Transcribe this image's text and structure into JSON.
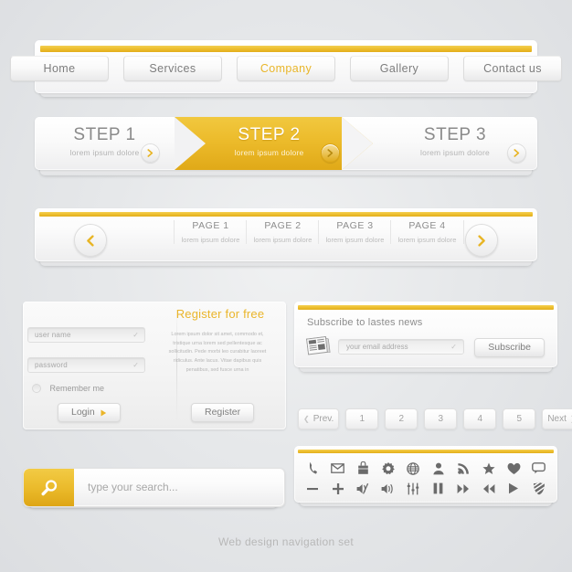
{
  "colors": {
    "accent": "#ebbb2c",
    "accent_dark": "#dea616",
    "text_gray": "#8a8a8a",
    "text_light": "#b4b4b4",
    "panel_bg": "#fafafa",
    "page_bg": "#e6e8ea"
  },
  "top_menu": {
    "items": [
      {
        "label": "Home",
        "active": false
      },
      {
        "label": "Services",
        "active": false
      },
      {
        "label": "Company",
        "active": true
      },
      {
        "label": "Gallery",
        "active": false
      },
      {
        "label": "Contact us",
        "active": false
      }
    ]
  },
  "steps": {
    "items": [
      {
        "title": "STEP 1",
        "subtitle": "lorem ipsum dolore",
        "active": false
      },
      {
        "title": "STEP 2",
        "subtitle": "lorem ipsum dolore",
        "active": true
      },
      {
        "title": "STEP 3",
        "subtitle": "lorem ipsum dolore",
        "active": false
      }
    ]
  },
  "pager": {
    "prev_icon": "chevron-left-icon",
    "next_icon": "chevron-right-icon",
    "pages": [
      {
        "title": "PAGE 1",
        "subtitle": "lorem ipsum dolore"
      },
      {
        "title": "PAGE 2",
        "subtitle": "lorem ipsum dolore"
      },
      {
        "title": "PAGE 3",
        "subtitle": "lorem ipsum dolore"
      },
      {
        "title": "PAGE 4",
        "subtitle": "lorem ipsum dolore"
      }
    ]
  },
  "login": {
    "username": {
      "placeholder": "user name",
      "value": "",
      "icon": "user-icon",
      "check": "✓"
    },
    "password": {
      "placeholder": "password",
      "value": "",
      "icon": "lock-icon",
      "check": "✓"
    },
    "remember_label": "Remember me",
    "remember_checked": false,
    "login_button": "Login",
    "login_button_icon": "play-triangle-icon"
  },
  "register": {
    "title": "Register for free",
    "body": "Lorem ipsum dolor sit amet, commodo et, tristique urna lorem sed pellentesque ac sollicitudin. Pede morbi leo curabitur laoreet ridiculus. Ante lacus. Vitae dapibus quis penatibus, sed fusce urna in",
    "button": "Register"
  },
  "subscribe": {
    "title": "Subscribe to lastes news",
    "icon": "newspaper-icon",
    "icon_text": "NEWS",
    "email": {
      "placeholder": "your email address",
      "value": "",
      "check": "✓"
    },
    "button": "Subscribe"
  },
  "number_pagination": {
    "prev": "Prev.",
    "next": "Next",
    "numbers": [
      "1",
      "2",
      "3",
      "4",
      "5"
    ]
  },
  "search": {
    "placeholder": "type your search...",
    "value": "",
    "icon": "magnifier-icon"
  },
  "icon_toolbar": {
    "row1": [
      {
        "name": "phone-icon"
      },
      {
        "name": "envelope-icon"
      },
      {
        "name": "briefcase-icon"
      },
      {
        "name": "gear-icon"
      },
      {
        "name": "globe-icon"
      },
      {
        "name": "user-icon"
      },
      {
        "name": "rss-icon"
      },
      {
        "name": "star-icon"
      },
      {
        "name": "heart-icon"
      },
      {
        "name": "speech-bubble-icon"
      }
    ],
    "row2": [
      {
        "name": "minus-icon"
      },
      {
        "name": "plus-icon"
      },
      {
        "name": "mute-icon"
      },
      {
        "name": "volume-icon"
      },
      {
        "name": "equalizer-icon"
      },
      {
        "name": "pause-icon"
      },
      {
        "name": "fast-forward-icon"
      },
      {
        "name": "rewind-icon"
      },
      {
        "name": "play-icon"
      },
      {
        "name": "striped-shield-icon"
      }
    ]
  },
  "caption": "Web design navigation set"
}
